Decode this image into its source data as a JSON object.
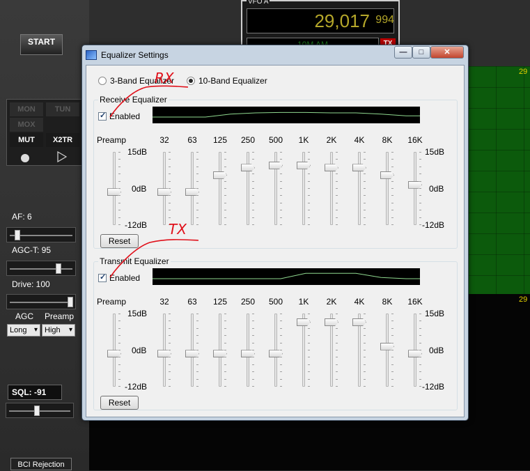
{
  "background": {
    "start_label": "START",
    "vfo_title": "VFO A",
    "vfo_freq_main": "29,017",
    "vfo_freq_sub": "994",
    "vfo_mode": "10M AM",
    "vfo_tx": "TX",
    "freq_mark_top": "29",
    "freq_mark_bottom": "29",
    "mode_buttons": [
      "MON",
      "TUN",
      "MOX",
      "MUT",
      "X2TR"
    ],
    "af_label": "AF:  6",
    "agct_label": "AGC-T:  95",
    "drive_label": "Drive:  100",
    "agc_label": "AGC",
    "preamp_label": "Preamp",
    "agc_value": "Long",
    "preamp_value": "High",
    "sql_label": "SQL:  -91",
    "bci_label": "BCI Rejection",
    "af_level": 0.1,
    "agct_level": 0.8,
    "drive_level": 1.0,
    "sql_level": 0.45
  },
  "dialog": {
    "title": "Equalizer Settings",
    "minimize_label": "—",
    "maximize_label": "□",
    "close_label": "✕",
    "mode_3band": "3-Band Equalizer",
    "mode_10band": "10-Band Equalizer",
    "selected_mode": "10-Band Equalizer"
  },
  "receive": {
    "group_label": "Receive Equalizer",
    "enabled_label": "Enabled",
    "enabled": true,
    "preamp_label": "Preamp",
    "bands": [
      "32",
      "63",
      "125",
      "250",
      "500",
      "1K",
      "2K",
      "4K",
      "8K",
      "16K"
    ],
    "db_top": "15dB",
    "db_mid": "0dB",
    "db_bottom": "-12dB",
    "preamp_db": 0,
    "band_db": [
      0,
      0,
      7,
      10,
      11,
      11,
      10,
      10,
      7,
      3
    ],
    "reset_label": "Reset"
  },
  "transmit": {
    "group_label": "Transmit Equalizer",
    "enabled_label": "Enabled",
    "enabled": true,
    "preamp_label": "Preamp",
    "bands": [
      "32",
      "63",
      "125",
      "250",
      "500",
      "1K",
      "2K",
      "4K",
      "8K",
      "16K"
    ],
    "db_top": "15dB",
    "db_mid": "0dB",
    "db_bottom": "-12dB",
    "preamp_db": 0,
    "band_db": [
      0,
      0,
      0,
      0,
      0,
      13,
      13,
      13,
      3,
      0
    ],
    "reset_label": "Reset"
  },
  "annotations": {
    "rx_text": "RX",
    "tx_text": "TX",
    "color": "#e0101a"
  }
}
